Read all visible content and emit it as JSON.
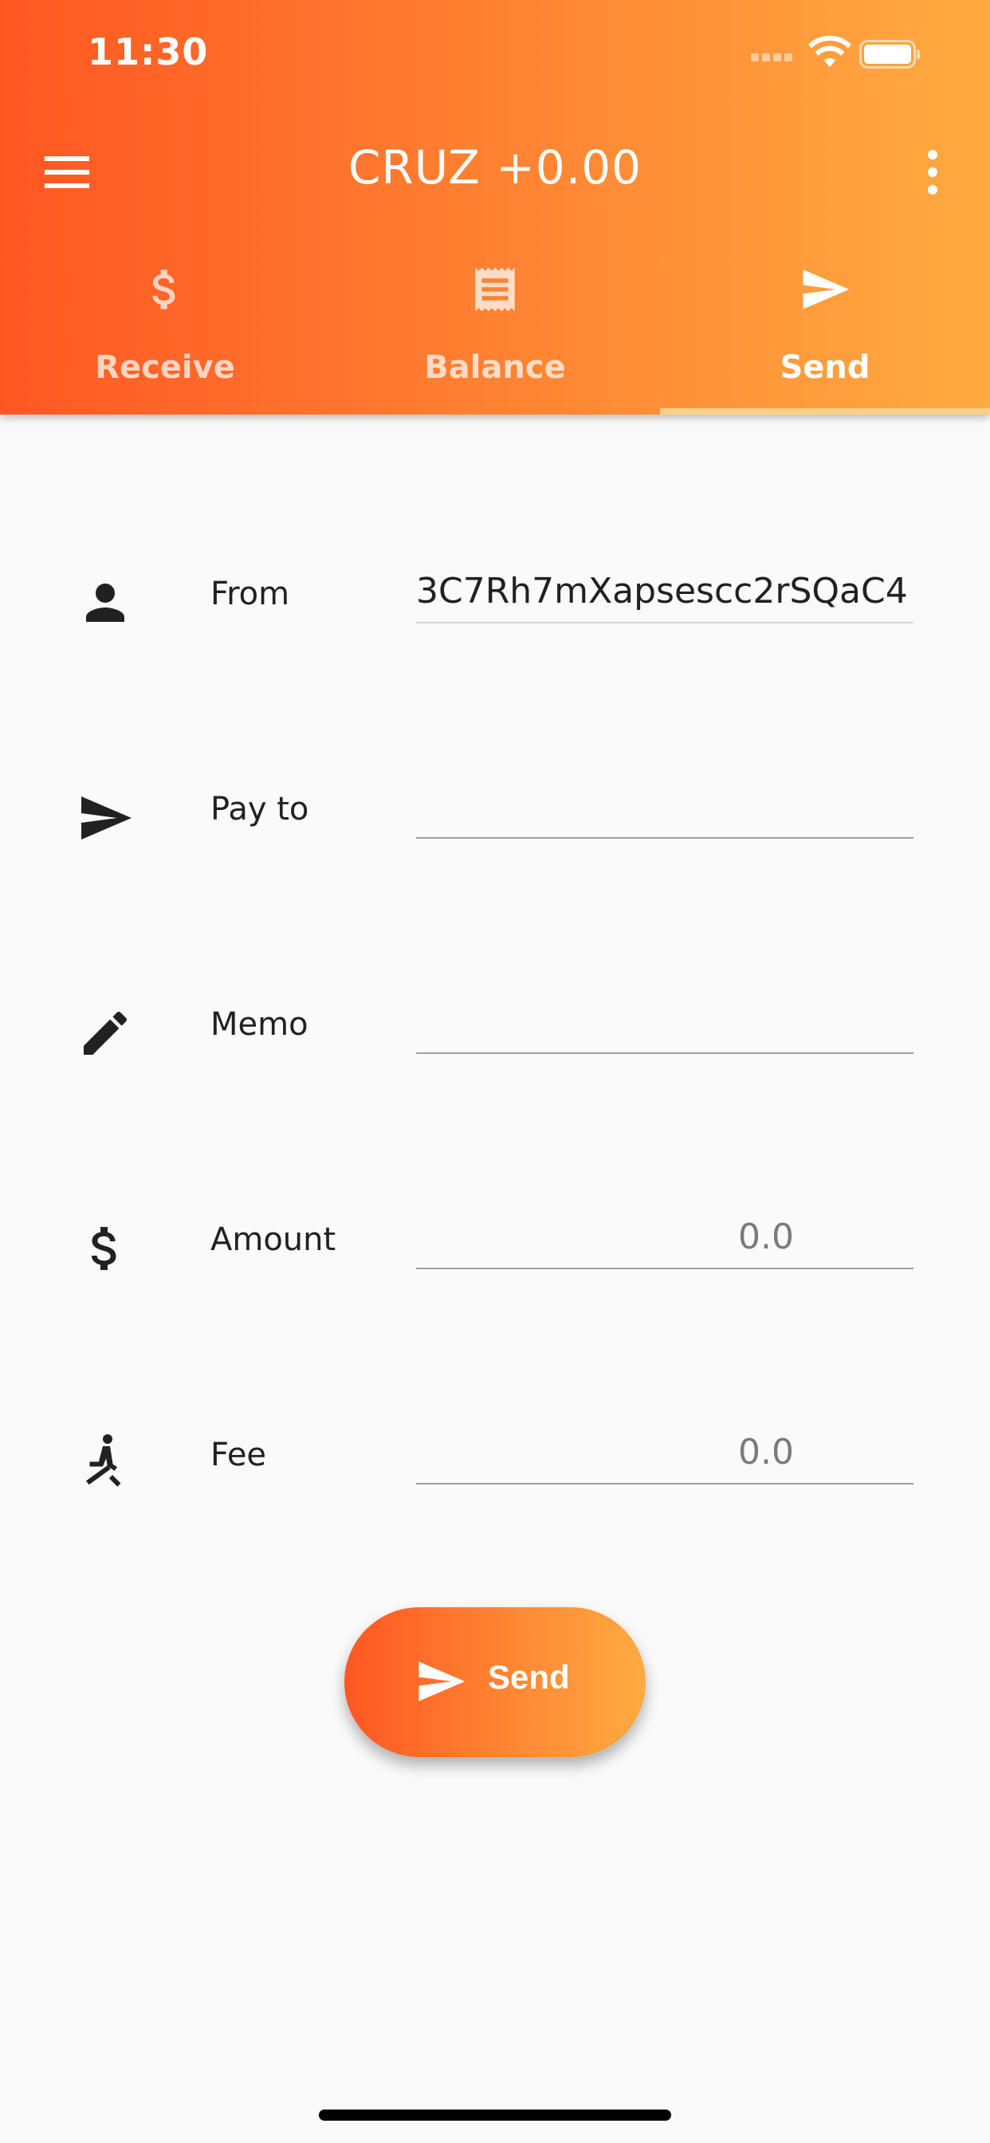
{
  "status_bar": {
    "time": "11:30"
  },
  "app_bar": {
    "title": "CRUZ +0.00",
    "menu_icon": "menu-icon",
    "more_icon": "more-vert-icon"
  },
  "tabs": [
    {
      "label": "Receive",
      "icon": "dollar-icon",
      "active": false
    },
    {
      "label": "Balance",
      "icon": "receipt-icon",
      "active": false
    },
    {
      "label": "Send",
      "icon": "send-icon",
      "active": true
    }
  ],
  "form": {
    "from": {
      "label": "From",
      "value": "3C7Rh7mXapsescc2rSQaC4",
      "icon": "person-icon"
    },
    "pay_to": {
      "label": "Pay to",
      "value": "",
      "icon": "send-icon"
    },
    "memo": {
      "label": "Memo",
      "value": "",
      "icon": "pencil-icon"
    },
    "amount": {
      "label": "Amount",
      "placeholder": "0.0",
      "icon": "dollar-icon"
    },
    "fee": {
      "label": "Fee",
      "placeholder": "0.0",
      "icon": "fee-icon"
    }
  },
  "send_button": {
    "label": "Send",
    "icon": "send-icon"
  },
  "colors": {
    "gradient_start": "#ff5722",
    "gradient_end": "#ffab40",
    "background": "#fafafa"
  }
}
